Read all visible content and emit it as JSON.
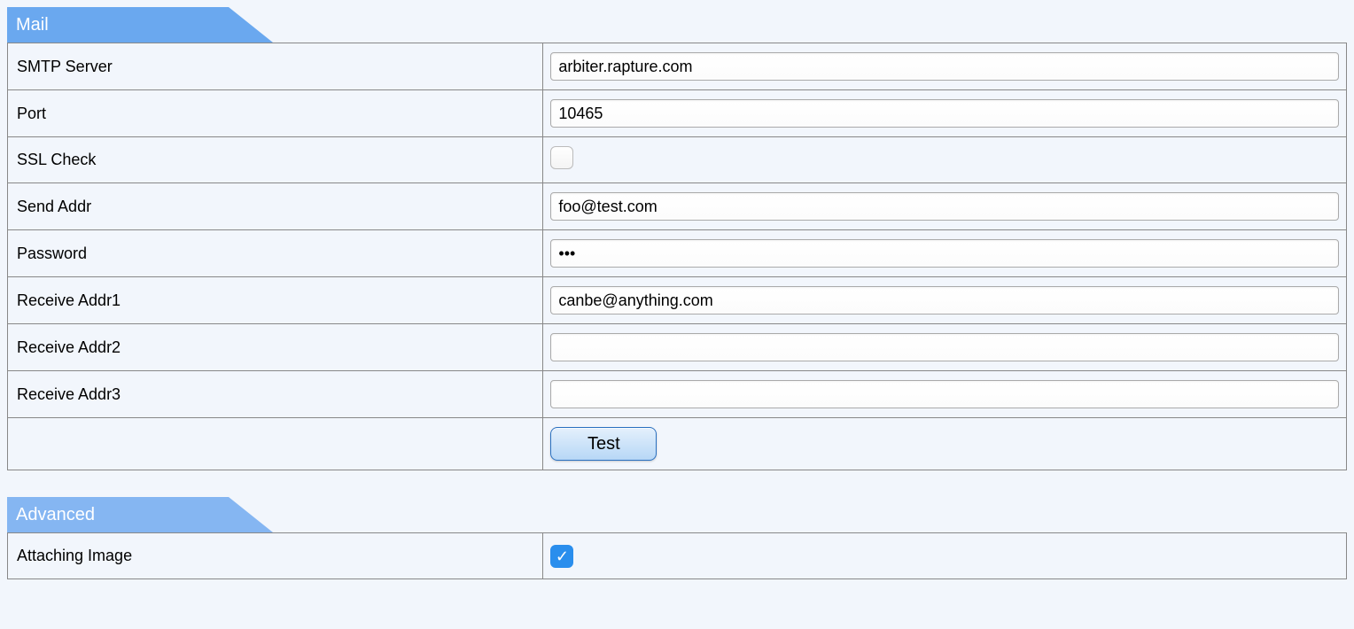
{
  "mail": {
    "title": "Mail",
    "rows": {
      "smtp_server": {
        "label": "SMTP Server",
        "value": "arbiter.rapture.com"
      },
      "port": {
        "label": "Port",
        "value": "10465"
      },
      "ssl_check": {
        "label": "SSL Check",
        "checked": false
      },
      "send_addr": {
        "label": "Send Addr",
        "value": "foo@test.com"
      },
      "password": {
        "label": "Password",
        "value": "•••"
      },
      "recv1": {
        "label": "Receive Addr1",
        "value": "canbe@anything.com"
      },
      "recv2": {
        "label": "Receive Addr2",
        "value": ""
      },
      "recv3": {
        "label": "Receive Addr3",
        "value": ""
      },
      "test_button": {
        "label": "Test"
      }
    }
  },
  "advanced": {
    "title": "Advanced",
    "rows": {
      "attaching_image": {
        "label": "Attaching Image",
        "checked": true
      }
    }
  }
}
